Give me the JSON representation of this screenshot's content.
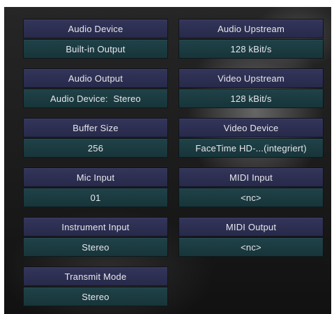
{
  "settings": {
    "audio_device": {
      "label": "Audio Device",
      "value": "Built-in Output"
    },
    "audio_upstream": {
      "label": "Audio Upstream",
      "value": "128 kBit/s"
    },
    "audio_output": {
      "label": "Audio Output",
      "value": "Audio Device:  Stereo"
    },
    "video_upstream": {
      "label": "Video Upstream",
      "value": "128 kBit/s"
    },
    "buffer_size": {
      "label": "Buffer Size",
      "value": "256"
    },
    "video_device": {
      "label": "Video Device",
      "value": "FaceTime HD-...(integriert)"
    },
    "mic_input": {
      "label": "Mic Input",
      "value": "01"
    },
    "midi_input": {
      "label": "MIDI Input",
      "value": "<nc>"
    },
    "instrument_input": {
      "label": "Instrument Input",
      "value": "Stereo"
    },
    "midi_output": {
      "label": "MIDI Output",
      "value": "<nc>"
    },
    "transmit_mode": {
      "label": "Transmit Mode",
      "value": "Stereo"
    }
  }
}
